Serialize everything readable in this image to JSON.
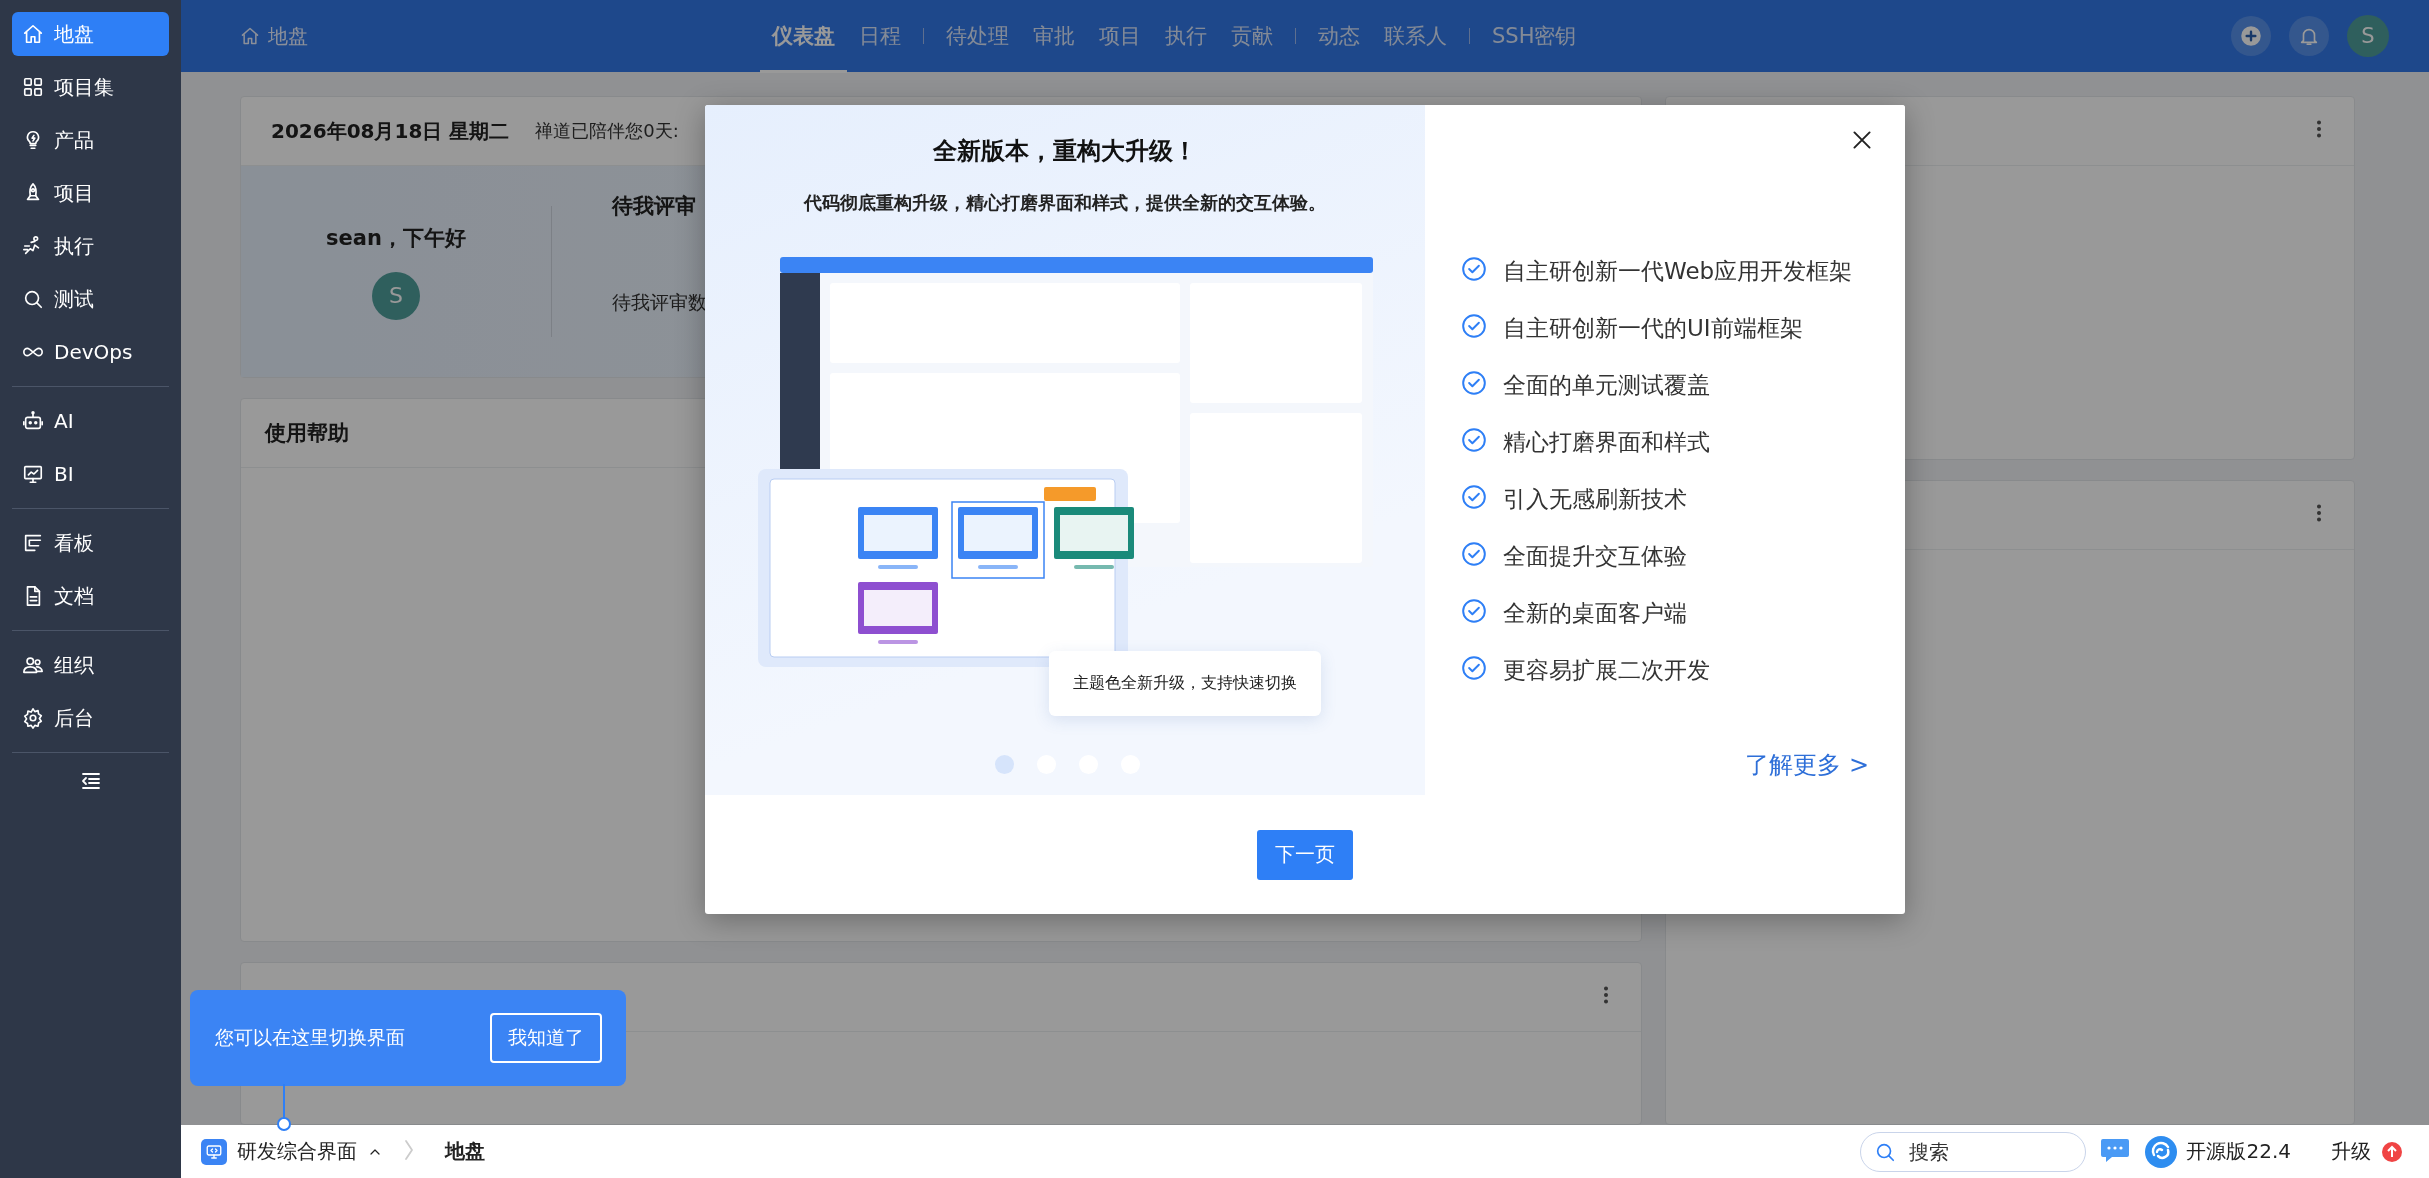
{
  "sidebar": {
    "groups": [
      {
        "items": [
          {
            "label": "地盘",
            "selected": true
          },
          {
            "label": "项目集",
            "selected": false
          },
          {
            "label": "产品",
            "selected": false
          },
          {
            "label": "项目",
            "selected": false
          },
          {
            "label": "执行",
            "selected": false
          },
          {
            "label": "测试",
            "selected": false
          },
          {
            "label": "DevOps",
            "selected": false
          }
        ]
      },
      {
        "items": [
          {
            "label": "AI",
            "selected": false
          },
          {
            "label": "BI",
            "selected": false
          }
        ]
      },
      {
        "items": [
          {
            "label": "看板",
            "selected": false
          },
          {
            "label": "文档",
            "selected": false
          }
        ]
      },
      {
        "items": [
          {
            "label": "组织",
            "selected": false
          },
          {
            "label": "后台",
            "selected": false
          }
        ]
      }
    ]
  },
  "topbar": {
    "breadcrumb": "地盘",
    "nav": [
      {
        "items": [
          {
            "label": "仪表盘",
            "selected": true
          },
          {
            "label": "日程",
            "selected": false
          }
        ]
      },
      {
        "items": [
          {
            "label": "待处理",
            "selected": false
          },
          {
            "label": "审批",
            "selected": false
          },
          {
            "label": "项目",
            "selected": false
          },
          {
            "label": "执行",
            "selected": false
          },
          {
            "label": "贡献",
            "selected": false
          }
        ]
      },
      {
        "items": [
          {
            "label": "动态",
            "selected": false
          },
          {
            "label": "联系人",
            "selected": false
          }
        ]
      },
      {
        "items": [
          {
            "label": "SSH密钥",
            "selected": false
          }
        ]
      }
    ],
    "avatar": "S"
  },
  "dashboard": {
    "date": "2026年08月18日 星期二",
    "companion": "禅道已陪伴您0天:",
    "greeting": "sean，下午好",
    "avatar": "S",
    "review_title": "待我评审",
    "review_label": "待我评审数",
    "help_title": "使用帮助"
  },
  "modal": {
    "title": "全新版本，重构大升级！",
    "subtitle": "代码彻底重构升级，精心打磨界面和样式，提供全新的交互体验。",
    "caption": "主题色全新升级，支持快速切换",
    "slides": [
      {
        "selected": true
      },
      {
        "selected": false
      },
      {
        "selected": false
      },
      {
        "selected": false
      }
    ],
    "features": [
      "自主研创新一代Web应用开发框架",
      "自主研创新一代的UI前端框架",
      "全面的单元测试覆盖",
      "精心打磨界面和样式",
      "引入无感刷新技术",
      "全面提升交互体验",
      "全新的桌面客户端",
      "更容易扩展二次开发"
    ],
    "more_link": "了解更多 >",
    "next_button": "下一页"
  },
  "tooltip": {
    "text": "您可以在这里切换界面",
    "button": "我知道了"
  },
  "status_bar": {
    "switcher": "研发综合界面",
    "crumb": "地盘",
    "search_placeholder": "搜索",
    "version": "开源版22.4",
    "upgrade": "升级"
  }
}
